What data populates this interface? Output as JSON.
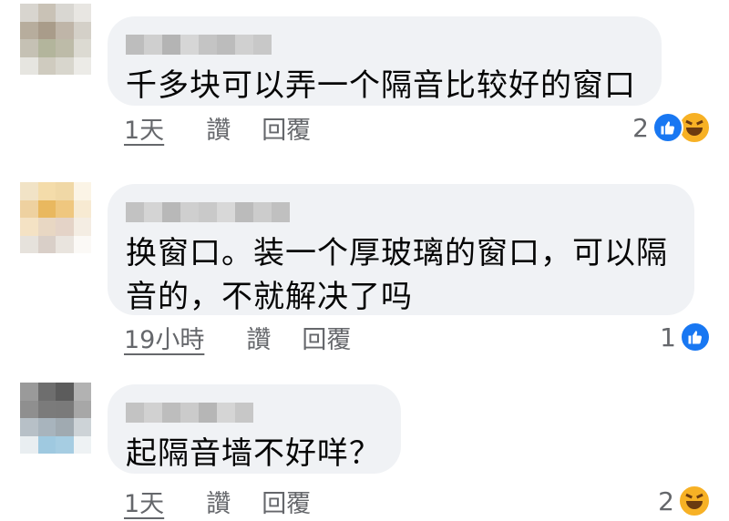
{
  "colors": {
    "bubble": "#f0f2f5",
    "meta_text": "#65676b",
    "like_blue": "#1877f2",
    "haha_yellow": "#f7b125"
  },
  "comments": [
    {
      "text": "千多块可以弄一个隔音比较好的窗口",
      "time": "1天",
      "like_label": "讚",
      "reply_label": "回覆",
      "reaction_count": "2",
      "reactions": [
        "like-icon",
        "haha-icon"
      ]
    },
    {
      "text": "换窗口。装一个厚玻璃的窗口，可以隔\n音的，不就解决了吗",
      "time": "19小時",
      "like_label": "讚",
      "reply_label": "回覆",
      "reaction_count": "1",
      "reactions": [
        "like-icon"
      ]
    },
    {
      "text": "起隔音墙不好咩？",
      "time": "1天",
      "like_label": "讚",
      "reply_label": "回覆",
      "reaction_count": "2",
      "reactions": [
        "haha-icon"
      ]
    }
  ]
}
